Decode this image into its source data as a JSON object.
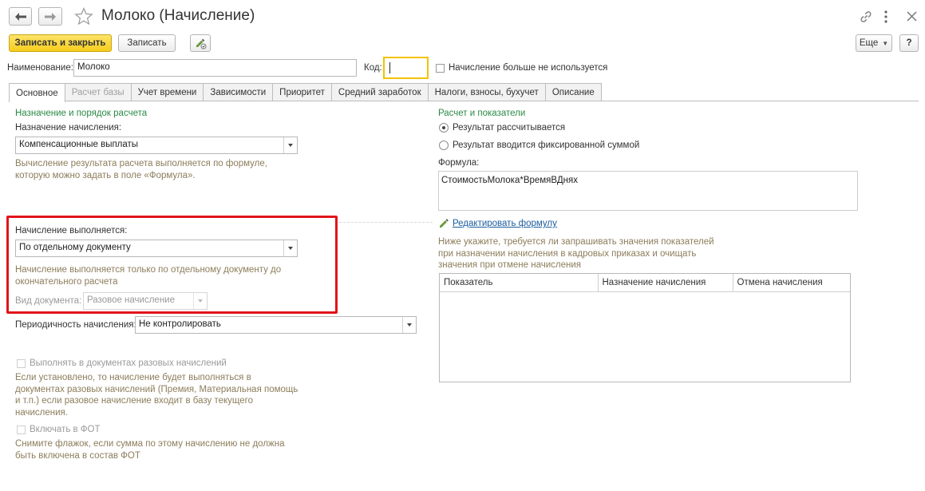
{
  "window": {
    "title": "Молоко (Начисление)"
  },
  "toolbar": {
    "save_close_label": "Записать и закрыть",
    "save_label": "Записать",
    "more_label": "Еще",
    "help_label": "?"
  },
  "header": {
    "name_label": "Наименование:",
    "name_value": "Молоко",
    "code_label": "Код:",
    "code_value": "",
    "unused_label": "Начисление больше не используется"
  },
  "tabs": [
    {
      "label": "Основное",
      "state": "active"
    },
    {
      "label": "Расчет базы",
      "state": "disabled"
    },
    {
      "label": "Учет времени",
      "state": "normal"
    },
    {
      "label": "Зависимости",
      "state": "normal"
    },
    {
      "label": "Приоритет",
      "state": "normal"
    },
    {
      "label": "Средний заработок",
      "state": "normal"
    },
    {
      "label": "Налоги, взносы, бухучет",
      "state": "normal"
    },
    {
      "label": "Описание",
      "state": "normal"
    }
  ],
  "left": {
    "section_title": "Назначение и порядок расчета",
    "purpose_label": "Назначение начисления:",
    "purpose_value": "Компенсационные выплаты",
    "purpose_hint": [
      "Вычисление результата расчета выполняется по формуле,",
      "которую можно задать в поле «Формула»."
    ],
    "exec_label": "Начисление выполняется:",
    "exec_value": "По отдельному документу",
    "exec_hint": [
      "Начисление выполняется только по отдельному документу до",
      "окончательного расчета"
    ],
    "doc_type_label": "Вид документа:",
    "doc_type_value": "Разовое начисление",
    "period_label": "Периодичность начисления:",
    "period_value": "Не контролировать",
    "one_time_label": "Выполнять в документах разовых начислений",
    "one_time_hint": [
      "Если установлено, то начисление будет выполняться в",
      "документах разовых начислений (Премия, Материальная помощь",
      "и т.п.) если разовое начисление входит в базу текущего",
      "начисления."
    ],
    "fot_label": "Включать в ФОТ",
    "fot_hint": [
      "Снимите флажок, если сумма по этому начислению не должна",
      "быть включена в состав ФОТ"
    ]
  },
  "right": {
    "section_title": "Расчет и показатели",
    "radio_calculated": "Результат рассчитывается",
    "radio_fixed": "Результат вводится фиксированной суммой",
    "formula_label": "Формула:",
    "formula_value": "СтоимостьМолока*ВремяВДнях",
    "edit_formula_link": "Редактировать формулу",
    "indicators_hint": [
      "Ниже укажите, требуется ли запрашивать значения показателей",
      "при назначении начисления в кадровых приказах и очищать",
      "значения при отмене начисления"
    ],
    "table_columns": [
      "Показатель",
      "Назначение начисления",
      "Отмена начисления"
    ]
  },
  "colors": {
    "primary_button": "#f6cd1c",
    "section_title": "#2a8a45",
    "hint_text": "#8c7d5b",
    "link": "#1a5c9e",
    "highlight_box": "#e0151b",
    "code_field_focus": "#f2c300"
  }
}
